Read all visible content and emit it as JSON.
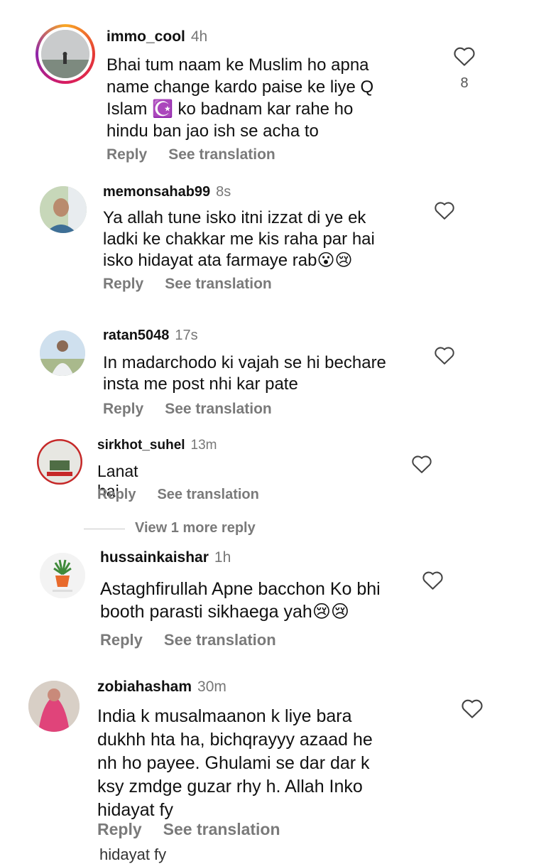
{
  "comments": [
    {
      "username": "immo_cool",
      "time": "4h",
      "text": "Bhai tum naam ke Muslim ho apna\nname change kardo paise ke liye Q\nIslam ☪️ ko badnam kar rahe ho\nhindu ban jao ish se acha to",
      "likes": "8",
      "reply_label": "Reply",
      "translate_label": "See translation"
    },
    {
      "username": "memonsahab99",
      "time": "8s",
      "text": "Ya allah tune isko itni izzat di ye ek\nladki ke chakkar me kis raha par hai\nisko hidayat ata farmaye rab😮😢",
      "reply_label": "Reply",
      "translate_label": "See translation"
    },
    {
      "username": "ratan5048",
      "time": "17s",
      "text": "In madarchodo ki vajah se hi bechare\ninsta me post nhi kar pate",
      "reply_label": "Reply",
      "translate_label": "See translation"
    },
    {
      "username": "sirkhot_suhel",
      "time": "13m",
      "text": "Lanat hai .",
      "reply_label": "Reply",
      "translate_label": "See translation"
    },
    {
      "username": "hussainkaishar",
      "time": "1h",
      "text": "Astaghfirullah Apne bacchon Ko bhi\nbooth parasti sikhaega yah😢😢",
      "reply_label": "Reply",
      "translate_label": "See translation"
    },
    {
      "username": "zobiahasham",
      "time": "30m",
      "text": "India k musalmaanon k liye bara\ndukhh hta ha, bichqrayyy azaad he\nnh ho payee. Ghulami se dar dar k\nksy zmdge guzar rhy h. Allah Inko\nhidayat fy",
      "reply_label": "Reply",
      "translate_label": "See translation"
    }
  ],
  "view_more_replies": "View 1 more reply",
  "cutoff_text": "hidayat fy",
  "icons": {
    "like": "heart-outline-icon"
  },
  "colors": {
    "story_ring_start": "#f9a825",
    "story_ring_end": "#d81b60",
    "muted": "#7a7a7a"
  }
}
